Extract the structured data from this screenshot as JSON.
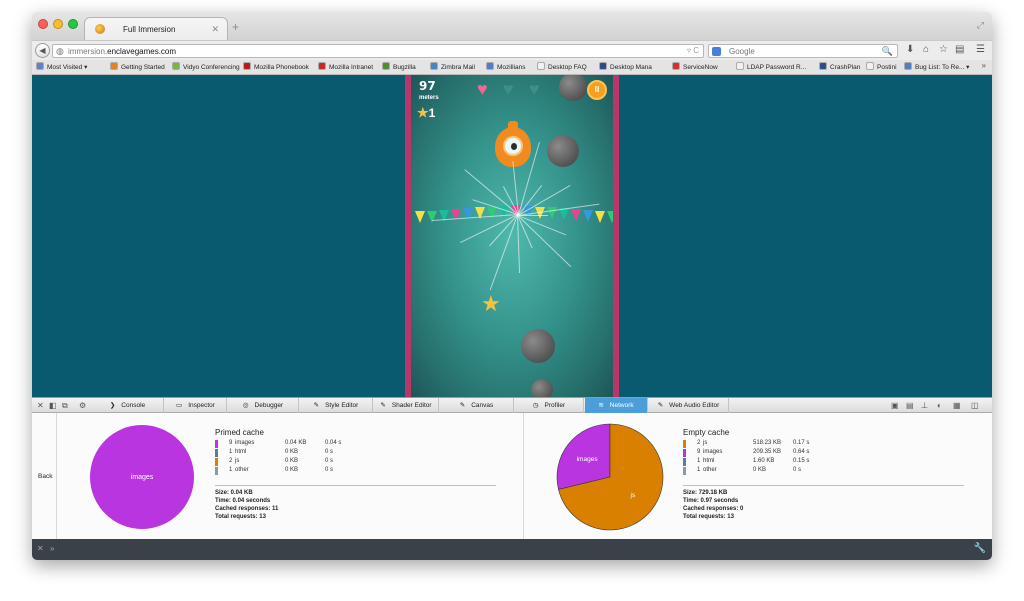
{
  "window": {
    "tab_title": "Full Immersion",
    "tab_close": "✕",
    "new_tab": "+",
    "url_domain_prefix": "immersion.",
    "url_domain_bold": "enclavegames.com",
    "url_tail": "▿ C",
    "search_placeholder": "Google",
    "search_icon": "🔍"
  },
  "nav_icons": [
    "⬇",
    "⌂",
    "☆",
    "▤",
    "☰"
  ],
  "bookmarks": [
    {
      "label": "Most Visited ▾",
      "color": "#5d84c8"
    },
    {
      "label": "Getting Started",
      "color": "#e8821e"
    },
    {
      "label": "Vidyo Conferencing",
      "color": "#7cb342"
    },
    {
      "label": "Mozilla Phonebook",
      "color": "#b71c1c"
    },
    {
      "label": "Mozilla Intranet",
      "color": "#c62828"
    },
    {
      "label": "Bugzilla",
      "color": "#558b2f"
    },
    {
      "label": "Zimbra Mail",
      "color": "#3f88c5"
    },
    {
      "label": "Mozillians",
      "color": "#4f7fc4"
    },
    {
      "label": "Desktop FAQ",
      "color": "#f1f1f1"
    },
    {
      "label": "Desktop Mana",
      "color": "#2e4c8c"
    },
    {
      "label": "ServiceNow",
      "color": "#d32f2f"
    },
    {
      "label": "LDAP Password R...",
      "color": "#f1f1f1"
    },
    {
      "label": "CrashPlan",
      "color": "#2e4c8c"
    },
    {
      "label": "Postini",
      "color": "#f1f1f1"
    },
    {
      "label": "Bug List: To Re... ▾",
      "color": "#4f7fc4"
    }
  ],
  "bookmarks_more": "»",
  "game": {
    "score": "97",
    "score_unit": "meters",
    "stars": "1",
    "pause": "II",
    "lives_full": 1,
    "lives_total": 3
  },
  "devtools": {
    "tabs": [
      {
        "label": "Console",
        "icon": "❯"
      },
      {
        "label": "Inspector",
        "icon": "▭"
      },
      {
        "label": "Debugger",
        "icon": "◎"
      },
      {
        "label": "Style Editor",
        "icon": "✎"
      },
      {
        "label": "Shader Editor",
        "icon": "✎"
      },
      {
        "label": "Canvas",
        "icon": "✎"
      },
      {
        "label": "Profiler",
        "icon": "◷"
      },
      {
        "label": "Network",
        "icon": "≋",
        "active": true
      },
      {
        "label": "Web Audio Editor",
        "icon": "✎"
      }
    ],
    "back_label": "Back",
    "accent": "#4c9ed9"
  },
  "primed": {
    "title": "Primed cache",
    "rows": [
      {
        "count": "9",
        "type": "images",
        "size": "0.04 KB",
        "time": "0.04 s",
        "color": "#b935e0"
      },
      {
        "count": "1",
        "type": "html",
        "size": "0 KB",
        "time": "0 s",
        "color": "#5a7ca4"
      },
      {
        "count": "2",
        "type": "js",
        "size": "0 KB",
        "time": "0 s",
        "color": "#d98000"
      },
      {
        "count": "1",
        "type": "other",
        "size": "0 KB",
        "time": "0 s",
        "color": "#8c9aa6"
      }
    ],
    "summary": {
      "size": "Size: 0.04 KB",
      "time": "Time: 0.04 seconds",
      "cached": "Cached responses: 11",
      "total": "Total requests: 13"
    }
  },
  "empty": {
    "title": "Empty cache",
    "rows": [
      {
        "count": "2",
        "type": "js",
        "size": "518.23 KB",
        "time": "0.17 s",
        "color": "#d98000"
      },
      {
        "count": "9",
        "type": "images",
        "size": "209.35 KB",
        "time": "0.64 s",
        "color": "#b935e0"
      },
      {
        "count": "1",
        "type": "html",
        "size": "1.60 KB",
        "time": "0.15 s",
        "color": "#5a7ca4"
      },
      {
        "count": "1",
        "type": "other",
        "size": "0 KB",
        "time": "0 s",
        "color": "#8c9aa6"
      }
    ],
    "summary": {
      "size": "Size: 729.18 KB",
      "time": "Time: 0.97 seconds",
      "cached": "Cached responses: 0",
      "total": "Total requests: 13"
    }
  },
  "chart_data": [
    {
      "type": "pie",
      "labels": [
        "images"
      ],
      "values": [
        0.04
      ],
      "slice_labels": [
        "images"
      ],
      "colors": [
        "#b935e0"
      ]
    },
    {
      "type": "pie",
      "labels": [
        "images",
        "js"
      ],
      "values": [
        209.35,
        518.23
      ],
      "slice_labels": [
        "images",
        "js"
      ],
      "colors": [
        "#b935e0",
        "#d98000"
      ]
    }
  ]
}
